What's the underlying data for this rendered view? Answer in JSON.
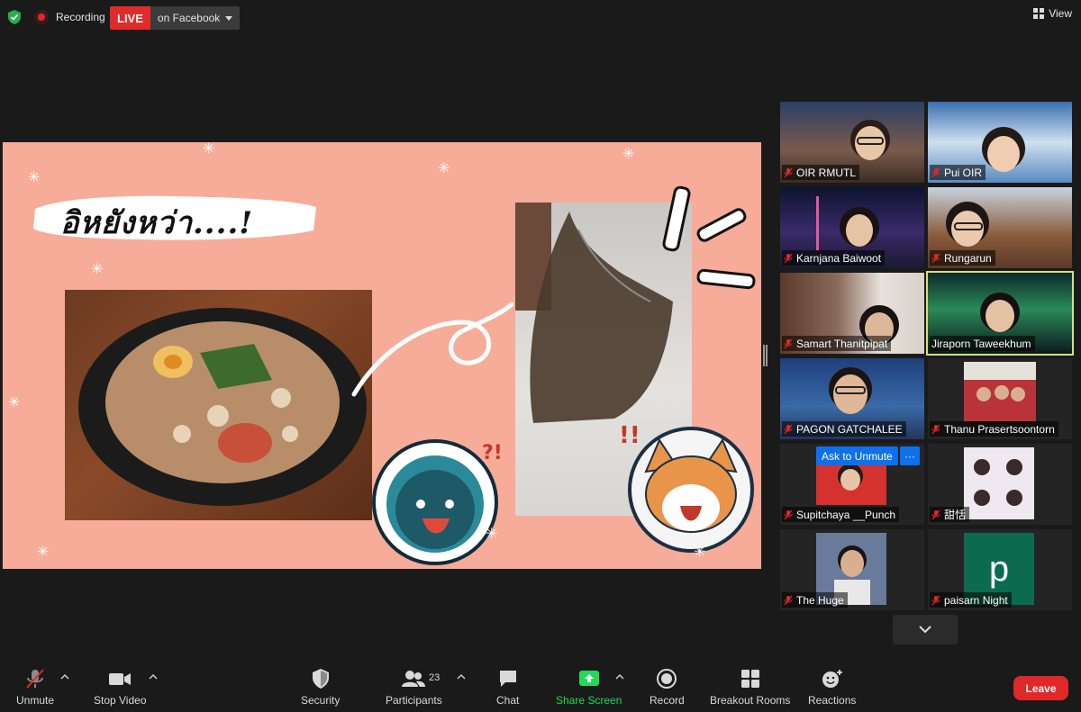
{
  "topbar": {
    "recording_label": "Recording",
    "live_label": "LIVE",
    "live_destination": "on Facebook",
    "view_label": "View"
  },
  "slide": {
    "title": "อิหยังหว่า....!"
  },
  "gallery": {
    "participants": [
      {
        "name": "OIR RMUTL",
        "muted": true
      },
      {
        "name": "Pui OIR",
        "muted": true
      },
      {
        "name": "Karnjana Baiwoot",
        "muted": true
      },
      {
        "name": "Rungarun",
        "muted": true
      },
      {
        "name": "Samart Thanitpipat",
        "muted": true
      },
      {
        "name": "Jiraporn Taweekhum",
        "muted": false,
        "active_speaker": true
      },
      {
        "name": "PAGON GATCHALEE",
        "muted": true
      },
      {
        "name": "Thanu Prasertsoontorn",
        "muted": true
      },
      {
        "name": "Supitchaya __Punch",
        "muted": true
      },
      {
        "name": "甜恬",
        "muted": true
      },
      {
        "name": "The Huge",
        "muted": true
      },
      {
        "name": "paisarn Night",
        "muted": true,
        "avatar_letter": "p"
      }
    ],
    "ask_unmute_label": "Ask to Unmute",
    "more_label": "···"
  },
  "toolbar": {
    "unmute_label": "Unmute",
    "stop_video_label": "Stop Video",
    "security_label": "Security",
    "participants_label": "Participants",
    "participants_count": "23",
    "chat_label": "Chat",
    "share_screen_label": "Share Screen",
    "record_label": "Record",
    "breakout_label": "Breakout Rooms",
    "reactions_label": "Reactions",
    "leave_label": "Leave"
  },
  "colors": {
    "background": "#1a1a1a",
    "slide_background": "#f6ac98",
    "live_red": "#e02b2b",
    "leave_red": "#e02828",
    "share_green": "#23d959",
    "ask_unmute_blue": "#0e71eb",
    "active_speaker_outline": "#d6e36d"
  }
}
